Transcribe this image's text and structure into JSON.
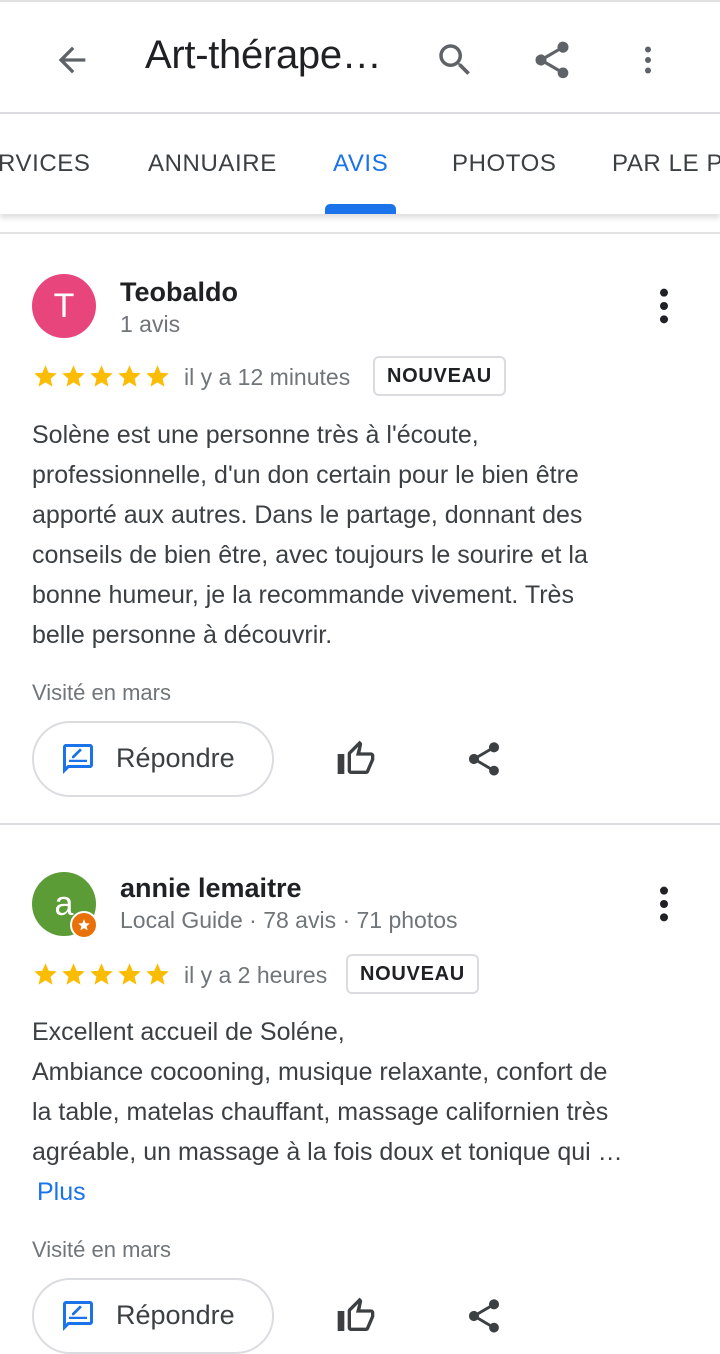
{
  "app_bar": {
    "title": "Art-thérape…",
    "icons": [
      "back-arrow-icon",
      "search-icon",
      "share-icon",
      "more-vert-icon"
    ]
  },
  "tabs": [
    {
      "label": "RVICES",
      "active": false
    },
    {
      "label": "ANNUAIRE",
      "active": false
    },
    {
      "label": "AVIS",
      "active": true
    },
    {
      "label": "PHOTOS",
      "active": false
    },
    {
      "label": "PAR LE PI",
      "active": false
    }
  ],
  "reviews": [
    {
      "author": "Teobaldo",
      "meta": "1 avis",
      "avatar_letter": "T",
      "avatar_color": "#e8457c",
      "local_guide": false,
      "rating": 5,
      "time": "il y a 12 minutes",
      "badge": "NOUVEAU",
      "text": "Solène est une personne très à l'écoute,\nprofessionnelle, d'un don certain pour le bien être\napporté aux autres. Dans le partage, donnant des\nconseils de bien être, avec toujours le sourire et la\nbonne humeur, je la recommande vivement. Très\nbelle personne à découvrir.",
      "more_label": "",
      "visited": "Visité en mars",
      "reply_label": "Répondre"
    },
    {
      "author": "annie lemaitre",
      "meta": "Local Guide · 78 avis · 71 photos",
      "avatar_letter": "a",
      "avatar_color": "#5b9c37",
      "local_guide": true,
      "rating": 5,
      "time": "il y a 2 heures",
      "badge": "NOUVEAU",
      "text": "Excellent accueil de Soléne,\nAmbiance cocooning, musique relaxante, confort de\nla table, matelas chauffant, massage californien très\nagréable, un massage à la fois doux et tonique qui …\n",
      "more_label": "Plus",
      "visited": "Visité en mars",
      "reply_label": "Répondre"
    }
  ],
  "colors": {
    "accent": "#1a73e8",
    "star": "#fbbc04",
    "secondary_text": "#70757a",
    "icon": "#5f6368"
  }
}
